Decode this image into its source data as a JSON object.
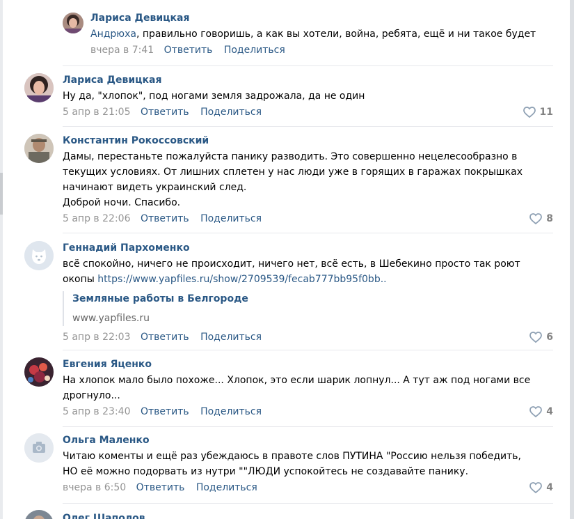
{
  "comments": [
    {
      "author": "Лариса Девицкая",
      "mention": "Андрюха",
      "text": ", правильно говоришь, а как вы хотели, война, ребята, ещё и ни такое будет",
      "date": "вчера в 7:41",
      "reply": "Ответить",
      "share": "Поделиться"
    },
    {
      "author": "Лариса Девицкая",
      "text": "Ну да, \"хлопок\", под ногами земля задрожала, да не один",
      "date": "5 апр в 21:05",
      "reply": "Ответить",
      "share": "Поделиться",
      "likes": "11"
    },
    {
      "author": "Константин Рокоссовский",
      "text_lines": [
        "Дамы, перестаньте пожалуйста панику разводить. Это совершенно нецелесообразно в",
        "текущих условиях. От лишних сплетен у нас люди уже в горящих в гаражах покрышках",
        "начинают видеть украинский след.",
        "Доброй ночи. Спасибо."
      ],
      "date": "5 апр в 22:06",
      "reply": "Ответить",
      "share": "Поделиться",
      "likes": "8"
    },
    {
      "author": "Геннадий Пархоменко",
      "text_line1": "всё спокойно, ничего не происходит, ничего нет, всё есть, в Шебекино просто так роют",
      "text_line2": "окопы ",
      "link": "https://www.yapfiles.ru/show/2709539/fecab777bb95f0bb..",
      "snippet_title": "Земляные работы в Белгороде",
      "snippet_host": "www.yapfiles.ru",
      "date": "5 апр в 22:03",
      "reply": "Ответить",
      "share": "Поделиться",
      "likes": "6"
    },
    {
      "author": "Евгения Яценко",
      "text_lines": [
        "На хлопок мало было похоже... Хлопок, это если шарик лопнул... А тут аж под ногами все",
        "дрогнуло..."
      ],
      "date": "5 апр в 23:40",
      "reply": "Ответить",
      "share": "Поделиться",
      "likes": "4"
    },
    {
      "author": "Ольга Маленко",
      "text_lines": [
        "Читаю коменты и ещё раз убеждаюсь в правоте слов ПУТИНА \"Россию нельзя победить,",
        "НО её можно подорвать из нутри \"\"ЛЮДИ успокойтесь не создавайте панику."
      ],
      "date": "вчера в 6:50",
      "reply": "Ответить",
      "share": "Поделиться",
      "likes": "4"
    },
    {
      "author": "Олег Шаполов"
    }
  ],
  "colors": {
    "link": "#2a5885",
    "meta": "#939393",
    "divider": "#e7e8ec"
  },
  "icons": {
    "like": "heart-icon",
    "camera": "camera-icon",
    "dog": "deactivated-dog-icon"
  }
}
